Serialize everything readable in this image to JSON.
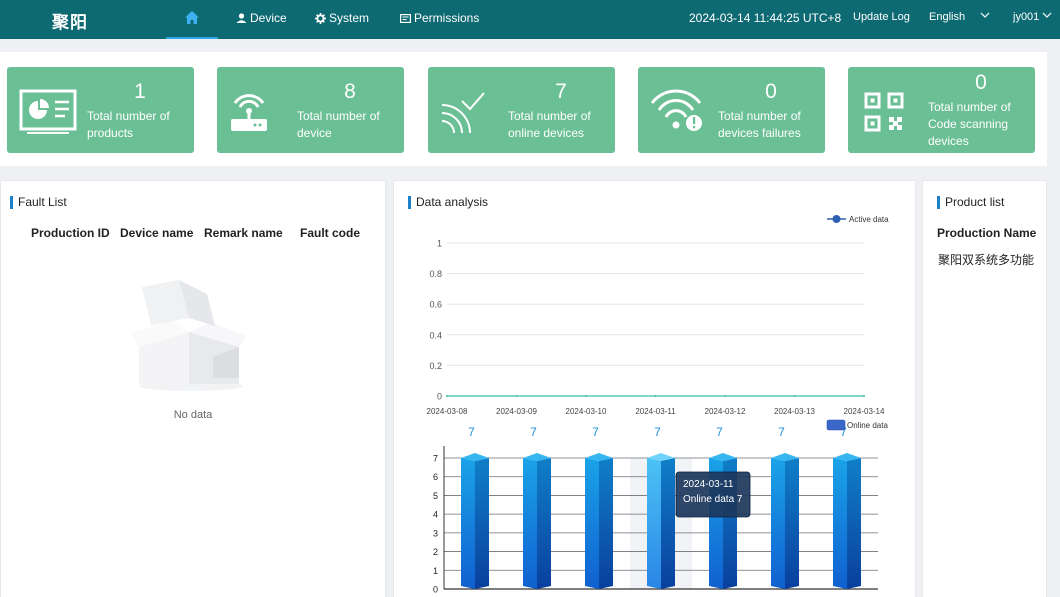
{
  "header": {
    "logo": "聚阳",
    "nav": [
      {
        "label": "Device",
        "icon": "user-icon"
      },
      {
        "label": "System",
        "icon": "gear-icon"
      },
      {
        "label": "Permissions",
        "icon": "id-card-icon"
      }
    ],
    "datetime": "2024-03-14 11:44:25 UTC+8",
    "update_log": "Update Log",
    "language": "English",
    "user": "jy001",
    "colors": {
      "bar": "#0e6a72",
      "active_indicator": "#2ea6e6"
    }
  },
  "stats": [
    {
      "value": "1",
      "label": "Total number of products",
      "icon": "dashboard-screen-icon"
    },
    {
      "value": "8",
      "label": "Total number of device",
      "icon": "router-icon"
    },
    {
      "value": "7",
      "label": "Total number of online devices",
      "icon": "signal-check-icon"
    },
    {
      "value": "0",
      "label": "Total number of devices failures",
      "icon": "wifi-alert-icon"
    },
    {
      "value": "0",
      "label": "Total number of Code scanning devices",
      "icon": "qr-code-icon"
    }
  ],
  "stat_card_color": "#6bbf95",
  "fault_list": {
    "title": "Fault List",
    "columns": [
      "Production ID",
      "Device name",
      "Remark name",
      "Fault code"
    ],
    "empty_text": "No data"
  },
  "data_analysis": {
    "title": "Data analysis"
  },
  "product_list": {
    "title": "Product list",
    "column": "Production Name",
    "items": [
      "聚阳双系统多功能"
    ]
  },
  "chart_data": [
    {
      "type": "line",
      "legend": [
        "Active data"
      ],
      "legend_position": "top-right",
      "x": [
        "2024-03-08",
        "2024-03-09",
        "2024-03-10",
        "2024-03-11",
        "2024-03-12",
        "2024-03-13",
        "2024-03-14"
      ],
      "series": [
        {
          "name": "Active data",
          "values": [
            0,
            0,
            0,
            0,
            0,
            0,
            0
          ]
        }
      ],
      "yticks": [
        "0",
        "0.2",
        "0.4",
        "0.6",
        "0.8",
        "1"
      ],
      "ylim": [
        0,
        1
      ],
      "grid": true,
      "colors": {
        "line": "#3bbfa0",
        "legend": "#2f5fb3"
      }
    },
    {
      "type": "bar",
      "legend": [
        "Online data"
      ],
      "legend_position": "top-right",
      "categories": [
        "2024-03-08",
        "2024-03-09",
        "2024-03-10",
        "2024-03-11",
        "2024-03-12",
        "2024-03-13",
        "2024-03-14"
      ],
      "series": [
        {
          "name": "Online data",
          "values": [
            7,
            7,
            7,
            7,
            7,
            7,
            7
          ]
        }
      ],
      "data_labels": [
        "7",
        "7",
        "7",
        "7",
        "7",
        "7",
        "7"
      ],
      "yticks": [
        "0",
        "1",
        "2",
        "3",
        "4",
        "5",
        "6",
        "7"
      ],
      "ylim": [
        0,
        7
      ],
      "grid": true,
      "tooltip": {
        "date": "2024-03-11",
        "text": "Online data 7"
      },
      "colors": {
        "bar_top": "#1aa3e8",
        "bar_bottom": "#1060d0",
        "label": "#1a8fd8"
      }
    }
  ]
}
